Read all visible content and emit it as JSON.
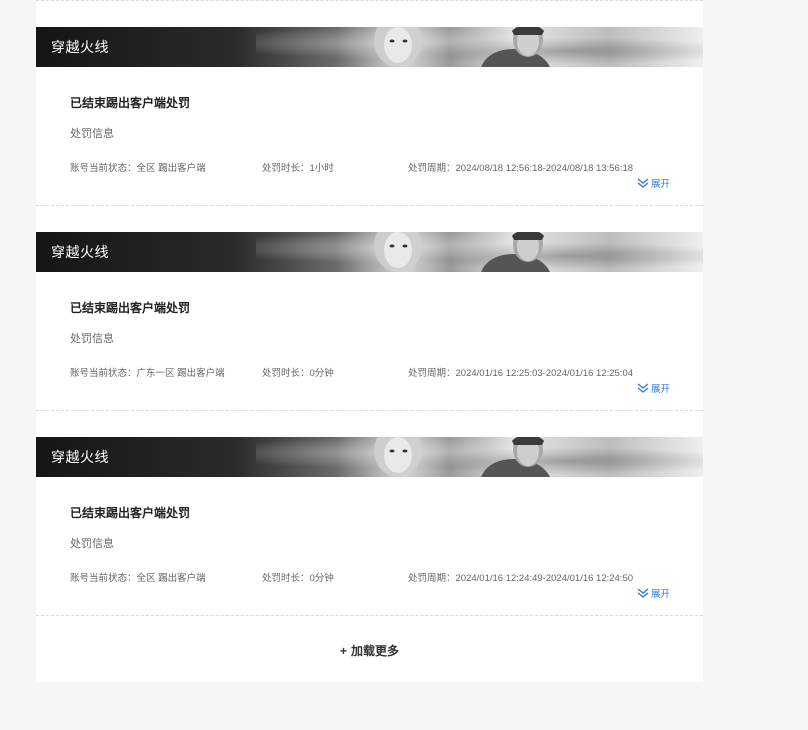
{
  "records": [
    {
      "banner_title": "穿越火线",
      "title": "已结束踢出客户端处罚",
      "subtitle": "处罚信息",
      "status_label": "账号当前状态：",
      "status_value": "全区 踢出客户端",
      "duration_label": "处罚时长：",
      "duration_value": "1小时",
      "period_label": "处罚周期：",
      "period_value": "2024/08/18 12:56:18-2024/08/18 13:56:18",
      "expand_label": "展开"
    },
    {
      "banner_title": "穿越火线",
      "title": "已结束踢出客户端处罚",
      "subtitle": "处罚信息",
      "status_label": "账号当前状态：",
      "status_value": "广东一区 踢出客户端",
      "duration_label": "处罚时长：",
      "duration_value": "0分钟",
      "period_label": "处罚周期：",
      "period_value": "2024/01/16 12:25:03-2024/01/16 12:25:04",
      "expand_label": "展开"
    },
    {
      "banner_title": "穿越火线",
      "title": "已结束踢出客户端处罚",
      "subtitle": "处罚信息",
      "status_label": "账号当前状态：",
      "status_value": "全区 踢出客户端",
      "duration_label": "处罚时长：",
      "duration_value": "0分钟",
      "period_label": "处罚周期：",
      "period_value": "2024/01/16 12:24:49-2024/01/16 12:24:50",
      "expand_label": "展开"
    }
  ],
  "load_more": {
    "plus": "+",
    "label": "加载更多"
  },
  "colors": {
    "accent_link": "#2f7ad6",
    "banner_dark": "#151515",
    "page_bg": "#f6f6f6"
  },
  "icons": {
    "expand": "double-chevron-down-icon"
  }
}
